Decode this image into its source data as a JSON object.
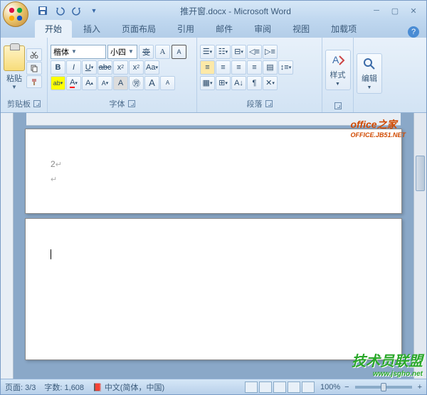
{
  "title": "推开窗.docx - Microsoft Word",
  "tabs": {
    "home": "开始",
    "insert": "插入",
    "layout": "页面布局",
    "references": "引用",
    "mail": "邮件",
    "review": "审阅",
    "view": "视图",
    "addins": "加载项"
  },
  "groups": {
    "clipboard": "剪贴板",
    "font": "字体",
    "paragraph": "段落",
    "styles": "样式",
    "editing": "编辑"
  },
  "clipboard": {
    "paste": "粘贴"
  },
  "font": {
    "name": "楷体",
    "size": "小四"
  },
  "styles": {
    "label": "样式"
  },
  "editing": {
    "label": "编辑"
  },
  "document": {
    "page1_text": "2",
    "page2_text": ""
  },
  "status": {
    "page": "页面: 3/3",
    "words": "字数: 1,608",
    "language": "中文(简体，中国)",
    "zoom": "100%"
  },
  "watermarks": {
    "office_home": "office之家",
    "office_url": "OFFICE.JB51.NET",
    "jsgho": "技术员联盟",
    "jsgho_url": "www.jsgho.net"
  }
}
